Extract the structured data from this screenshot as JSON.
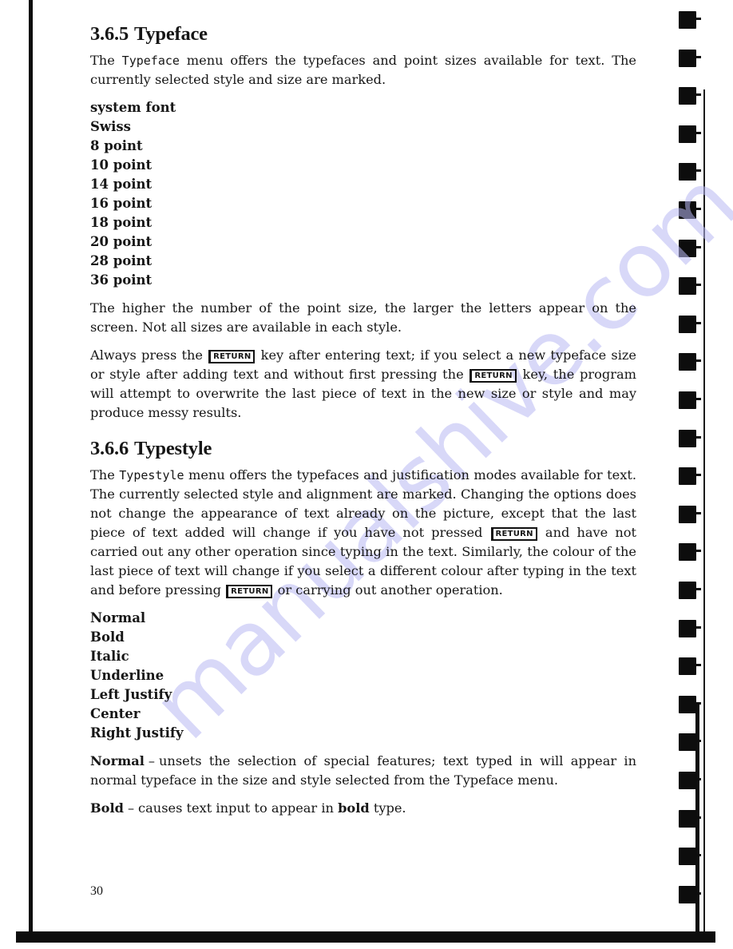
{
  "page": {
    "page_number": "30",
    "watermark": "manualshive.com"
  },
  "section_typeface": {
    "number": "3.6.5",
    "title": "Typeface",
    "intro_before": "The ",
    "intro_menu_name": "Typeface",
    "intro_after": " menu offers the typefaces and point sizes available for text. The currently selected style and size are marked.",
    "menu_items": [
      "system font",
      "Swiss",
      "8 point",
      "10 point",
      "14 point",
      "16 point",
      "18 point",
      "20 point",
      "28 point",
      "36 point"
    ],
    "point_size_note": "The higher the number of the point size, the larger the letters appear on the screen. Not all sizes are available in each style.",
    "return_note": {
      "part1": "Always press the ",
      "key1": "RETURN",
      "part2": " key after entering text; if you select a new typeface size or style after adding text and without first pressing the ",
      "key2": "RETURN",
      "part3": " key, the program will attempt to overwrite the last piece of text in the new size or style and may produce messy results."
    }
  },
  "section_typestyle": {
    "number": "3.6.6",
    "title": "Typestyle",
    "intro": {
      "part1": "The ",
      "menu_name": "Typestyle",
      "part2": " menu offers the typefaces and justification modes available for text. The currently selected style and alignment are marked. Changing the options does not change the appearance of text already on the picture, except that the last piece of text added will change if you have not pressed ",
      "key1": "RETURN",
      "part3": " and have not carried out any other operation since typing in the text. Similarly, the colour of the last piece of text will change if you select a different colour after typing in the text and before pressing ",
      "key2": "RETURN",
      "part4": " or carrying out another operation."
    },
    "menu_items": [
      "Normal",
      "Bold",
      "Italic",
      "Underline",
      "Left Justify",
      "Center",
      "Right Justify"
    ],
    "definitions": [
      {
        "term": "Normal",
        "dash": "–",
        "text": "unsets the selection of special features; text typed in will appear in normal typeface in the size and style selected from the Typeface menu."
      },
      {
        "term": "Bold",
        "dash": "–",
        "text_before": "causes text input to appear in ",
        "emphasis": "bold",
        "text_after": " type."
      }
    ]
  }
}
